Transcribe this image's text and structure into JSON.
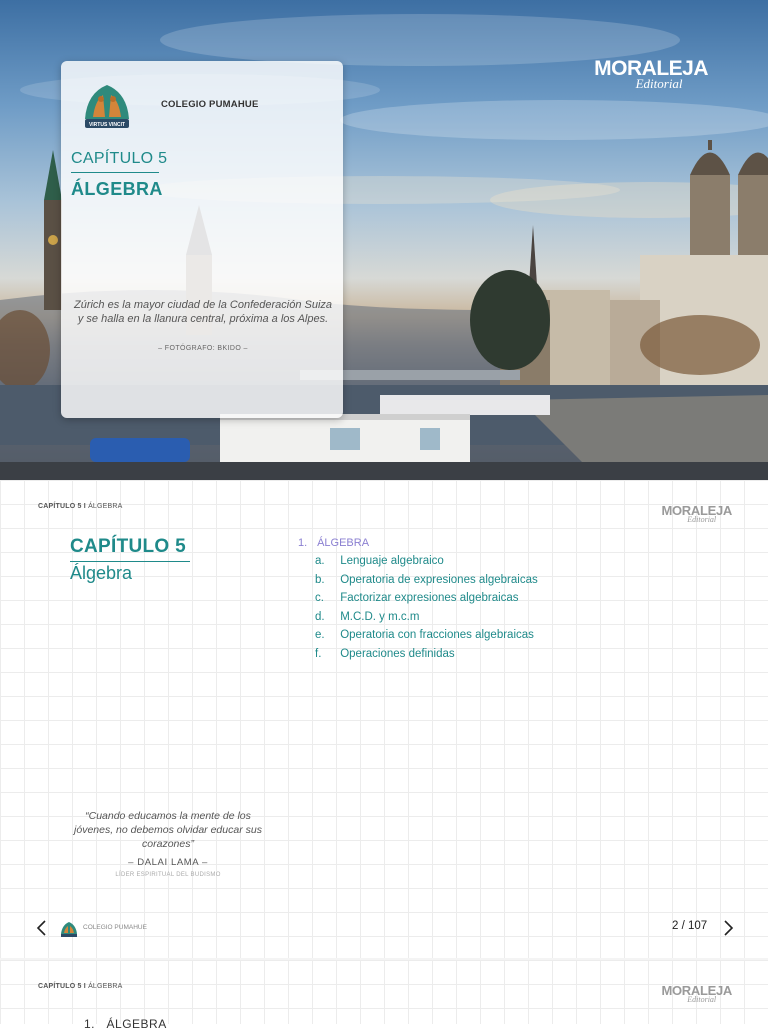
{
  "cover": {
    "brand": {
      "name": "MORALEJA",
      "tagline": "Editorial"
    },
    "school": "COLEGIO PUMAHUE",
    "crest_motto": "VIRTUS VINCIT",
    "chapter": "CAPÍTULO 5",
    "subject": "ÁLGEBRA",
    "caption": "Zúrich es la mayor ciudad de la Confederación Suiza y se halla en la llanura central, próxima a los Alpes.",
    "photo_credit": "– FOTÓGRAFO: BKIDO –"
  },
  "page2": {
    "running_head": {
      "chapter": "CAPÍTULO 5 I",
      "subject": "ÁLGEBRA"
    },
    "brand": {
      "name": "MORALEJA",
      "tagline": "Editorial"
    },
    "chapter": "CAPÍTULO 5",
    "subject": "Álgebra",
    "toc": {
      "section_number": "1.",
      "section_title": "ÁLGEBRA",
      "items": [
        {
          "letter": "a.",
          "label": "Lenguaje algebraico"
        },
        {
          "letter": "b.",
          "label": "Operatoria de expresiones algebraicas"
        },
        {
          "letter": "c.",
          "label": "Factorizar expresiones algebraicas"
        },
        {
          "letter": "d.",
          "label": "M.C.D. y m.c.m"
        },
        {
          "letter": "e.",
          "label": "Operatoria con fracciones algebraicas"
        },
        {
          "letter": "f.",
          "label": "Operaciones definidas"
        }
      ]
    },
    "quote": {
      "text": "“Cuando educamos la mente de los jóvenes, no debemos olvidar educar sus corazones”",
      "author": "– DALAI LAMA –",
      "role": "LÍDER ESPIRITUAL DEL BUDISMO"
    },
    "footer": {
      "school": "COLEGIO PUMAHUE",
      "page_indicator": "2 / 107"
    }
  },
  "page3": {
    "running_head": {
      "chapter": "CAPÍTULO 5 I",
      "subject": "ÁLGEBRA"
    },
    "brand": {
      "name": "MORALEJA",
      "tagline": "Editorial"
    },
    "section": "1.   ÁLGEBRA"
  },
  "colors": {
    "accent_teal": "#1f8a8a",
    "toc_section_purple": "#8a7fd1",
    "grid_line": "#ececec"
  },
  "icons": {
    "prev": "chevron-left-icon",
    "next": "chevron-right-icon",
    "crest": "school-crest-icon"
  }
}
